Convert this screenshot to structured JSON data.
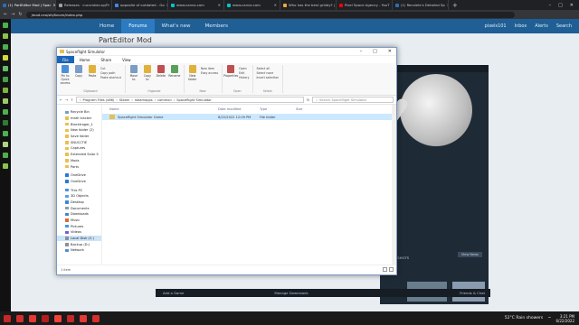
{
  "browser": {
    "tabs": [
      {
        "label": "(1) PartEditor Mod | Spac",
        "color": "#2a6ebb",
        "active": true
      },
      {
        "label": "Releases · cucumber-sp/Pr",
        "color": "#9aa0a6",
        "active": false
      },
      {
        "label": "opposite of outdated - Go",
        "color": "#4285f4",
        "active": false
      },
      {
        "label": "www.canva.com",
        "color": "#00c4cc",
        "active": false
      },
      {
        "label": "www.canva.com",
        "color": "#00c4cc",
        "active": false
      },
      {
        "label": "Who has the best griddy? |",
        "color": "#f2a541",
        "active": false
      },
      {
        "label": "Pixel Space Agency - YouT",
        "color": "#ff0000",
        "active": false
      },
      {
        "label": "(1) Recolets's Detailed Sp",
        "color": "#2a6ebb",
        "active": false
      }
    ],
    "new_tab": "+",
    "url": "jmod.ceo/sfs/forum/index.php"
  },
  "site": {
    "nav": [
      {
        "label": "Home",
        "selected": false
      },
      {
        "label": "Forums",
        "selected": true
      },
      {
        "label": "What's new",
        "selected": false
      },
      {
        "label": "Members",
        "selected": false
      }
    ],
    "user": "pixels101",
    "inbox": "Inbox",
    "alerts": "Alerts",
    "search": "Search",
    "page_title": "PartEditor Mod"
  },
  "steam": {
    "header": "pixels",
    "news_button": "View News",
    "screenshots_label": "ENSHOTS",
    "add_game": "Add a Game",
    "manage_downloads": "Manage Downloads",
    "friends_chat": "Friends & Chat"
  },
  "explorer": {
    "title": "Spaceflight Simulator",
    "menu": [
      "File",
      "Home",
      "Share",
      "View"
    ],
    "ribbon": {
      "clipboard": {
        "label": "Clipboard",
        "big": [
          "Pin to Quick access",
          "Copy",
          "Paste"
        ],
        "small": [
          "Cut",
          "Copy path",
          "Paste shortcut"
        ]
      },
      "organize": {
        "label": "Organize",
        "big": [
          "Move to",
          "Copy to",
          "Delete",
          "Rename"
        ]
      },
      "new": {
        "label": "New",
        "big": [
          "New folder"
        ],
        "small": [
          "New item",
          "Easy access"
        ]
      },
      "open": {
        "label": "Open",
        "big": [
          "Properties"
        ],
        "small": [
          "Open",
          "Edit",
          "History"
        ]
      },
      "select": {
        "label": "Select",
        "small": [
          "Select all",
          "Select none",
          "Invert selection"
        ]
      }
    },
    "path": [
      "Program Files (x86)",
      "Steam",
      "steamapps",
      "common",
      "Spaceflight Simulator"
    ],
    "search_placeholder": "Search Spaceflight Simulator",
    "nav_items": [
      {
        "label": "Recycle Bin",
        "color": "#7a9cc6"
      },
      {
        "label": "math tracker",
        "color": "#e8c04c"
      },
      {
        "label": "Blacktrager_1",
        "color": "#e8c04c"
      },
      {
        "label": "New folder (2)",
        "color": "#e8c04c"
      },
      {
        "label": "Save folder",
        "color": "#e8c04c"
      },
      {
        "label": "SNUCCTIE",
        "color": "#e8c04c"
      },
      {
        "label": "Captures",
        "color": "#e8c04c"
      },
      {
        "label": "Extended Solar S",
        "color": "#e8c04c"
      },
      {
        "label": "Mods",
        "color": "#e8c04c"
      },
      {
        "label": "Parts",
        "color": "#e8c04c"
      },
      {
        "label": "",
        "color": "",
        "gap": true
      },
      {
        "label": "OneDrive",
        "color": "#2b78d4"
      },
      {
        "label": "OneDrive",
        "color": "#2b78d4"
      },
      {
        "label": "",
        "color": "",
        "gap": true
      },
      {
        "label": "This PC",
        "color": "#4a90d9"
      },
      {
        "label": "3D Objects",
        "color": "#5aa0e0"
      },
      {
        "label": "Desktop",
        "color": "#3c86d8"
      },
      {
        "label": "Documents",
        "color": "#8a9aac"
      },
      {
        "label": "Downloads",
        "color": "#3c86d8"
      },
      {
        "label": "Music",
        "color": "#d86a3c"
      },
      {
        "label": "Pictures",
        "color": "#3c9ad8"
      },
      {
        "label": "Videos",
        "color": "#7a5ad8"
      },
      {
        "label": "Local Disk (C:)",
        "color": "#8a8f98",
        "selected": true
      },
      {
        "label": "Backup (D:)",
        "color": "#8a8f98"
      },
      {
        "label": "Network",
        "color": "#4a90d9"
      }
    ],
    "columns": [
      "Name",
      "Date modified",
      "Type",
      "Size"
    ],
    "files": [
      {
        "name": "Spaceflight Simulator Game",
        "date": "6/22/2022 12:09 PM",
        "type": "File folder",
        "size": ""
      }
    ],
    "status": "1 item"
  },
  "taskbar": {
    "weather": "52°C Rain showers",
    "time": "3:21 PM",
    "date": "6/22/2022"
  }
}
